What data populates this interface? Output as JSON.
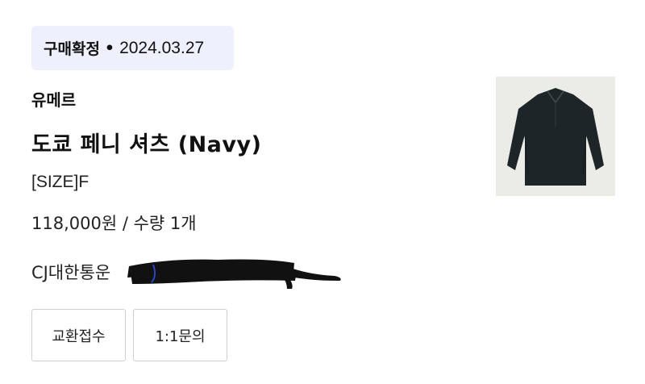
{
  "order": {
    "status_label": "구매확정",
    "separator": "•",
    "status_date": "2024.03.27"
  },
  "product": {
    "brand": "유메르",
    "name": "도쿄 페니 셔츠 (Navy)",
    "option": "[SIZE]F",
    "price_quantity": "118,000원 / 수량 1개",
    "image_icon": "navy-shirt-thumbnail"
  },
  "shipping": {
    "courier": "CJ대한통운"
  },
  "actions": {
    "exchange_label": "교환접수",
    "inquiry_label": "1:1문의"
  },
  "colors": {
    "badge_bg": "#eef1fd",
    "shirt": "#1e2528",
    "redaction": "#111111"
  }
}
